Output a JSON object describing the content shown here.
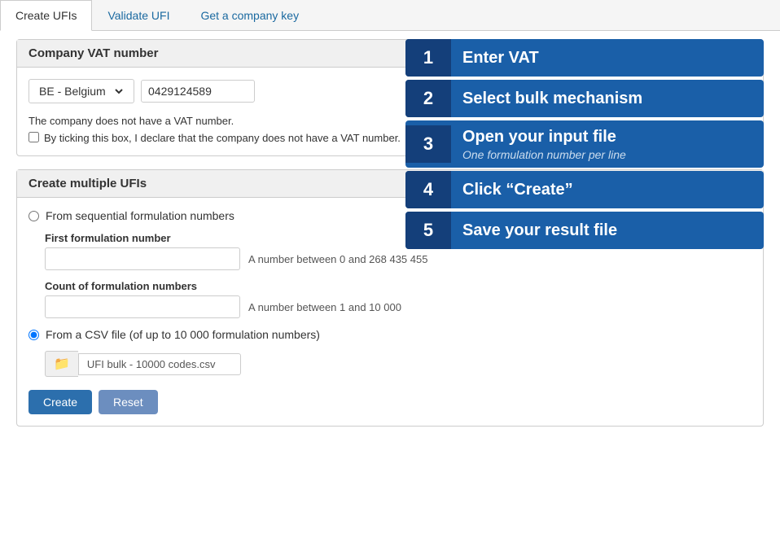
{
  "tabs": [
    {
      "id": "create-ufis",
      "label": "Create UFIs",
      "active": true
    },
    {
      "id": "validate-ufi",
      "label": "Validate UFI",
      "active": false
    },
    {
      "id": "get-company-key",
      "label": "Get a company key",
      "active": false
    }
  ],
  "vat_section": {
    "title": "Company VAT number",
    "country_value": "BE - Belgium",
    "vat_value": "0429124589",
    "no_vat_text": "The company does not have a VAT number.",
    "no_vat_checkbox_label": "By ticking this box, I declare that the company does not have a VAT number."
  },
  "ufi_section": {
    "title": "Create multiple UFIs",
    "option_sequential_label": "From sequential formulation numbers",
    "field_first_number_label": "First formulation number",
    "field_first_number_placeholder": "",
    "field_first_number_hint": "A number between 0 and 268 435 455",
    "field_count_label": "Count of formulation numbers",
    "field_count_placeholder": "",
    "field_count_hint": "A number between 1 and 10 000",
    "option_csv_label": "From a CSV file (of up to 10 000 formulation numbers)",
    "file_name": "UFI bulk - 10000 codes.csv",
    "btn_create": "Create",
    "btn_reset": "Reset"
  },
  "steps": [
    {
      "number": "1",
      "title": "Enter VAT",
      "subtitle": ""
    },
    {
      "number": "2",
      "title": "Select bulk mechanism",
      "subtitle": ""
    },
    {
      "number": "3",
      "title": "Open your input file",
      "subtitle": "One formulation number per line"
    },
    {
      "number": "4",
      "title": "Click “Create”",
      "subtitle": ""
    },
    {
      "number": "5",
      "title": "Save your result file",
      "subtitle": ""
    }
  ]
}
